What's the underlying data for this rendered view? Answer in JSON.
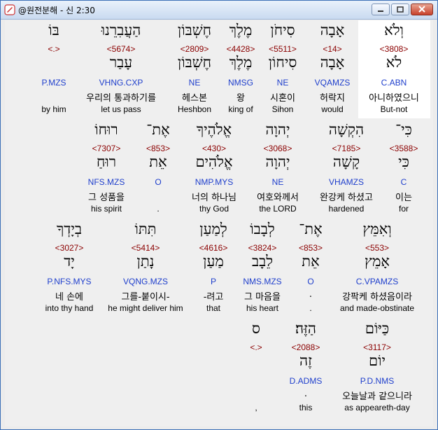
{
  "window": {
    "title": "@원전분해 - 신 2:30"
  },
  "rows": [
    {
      "id": "row1",
      "words": [
        {
          "heb": "וְלֹא",
          "strong": "<3808>",
          "lemma": "לֹא",
          "morph": "C.ABN",
          "kor": "아니하였으니",
          "eng": "But-not"
        },
        {
          "heb": "אָבָה",
          "strong": "<14>",
          "lemma": "אָבָה",
          "morph": "VQAMZS",
          "kor": "허락지",
          "eng": "would"
        },
        {
          "heb": "סִיחֹן",
          "strong": "<5511>",
          "lemma": "סִיחוֹן",
          "morph": "NE",
          "kor": "시혼이",
          "eng": "Sihon"
        },
        {
          "heb": "מֶלֶךְ",
          "strong": "<4428>",
          "lemma": "מֶלֶךְ",
          "morph": "NMSG",
          "kor": "왕",
          "eng": "king of"
        },
        {
          "heb": "חֶשְׁבּוֹן",
          "strong": "<2809>",
          "lemma": "חֶשְׁבּוֹן",
          "morph": "NE",
          "kor": "헤스본",
          "eng": "Heshbon"
        },
        {
          "heb": "הַעֲבִרֵנוּ",
          "strong": "<5674>",
          "lemma": "עָבַר",
          "morph": "VHNG.CXP",
          "kor": "우리의 통과하기를",
          "eng": "let us pass"
        },
        {
          "heb": "בּוֹ",
          "strong": "<.>",
          "lemma": "",
          "morph": "P.MZS",
          "kor": "",
          "eng": "by him"
        }
      ]
    },
    {
      "id": "row2",
      "words": [
        {
          "heb": "כִּי־",
          "strong": "<3588>",
          "lemma": "כִּי",
          "morph": "C",
          "kor": "이는",
          "eng": "for"
        },
        {
          "heb": "הִקְשָׁה",
          "strong": "<7185>",
          "lemma": "קָשָׁה",
          "morph": "VHAMZS",
          "kor": "완강케 하셨고",
          "eng": "hardened"
        },
        {
          "heb": "יְהוָה",
          "strong": "<3068>",
          "lemma": "יְהוָה",
          "morph": "NE",
          "kor": "여호와께서",
          "eng": "the LORD"
        },
        {
          "heb": "אֱלֹהֶיךָ",
          "strong": "<430>",
          "lemma": "אֱלֹהִים",
          "morph": "NMP.MYS",
          "kor": "너의 하나님",
          "eng": "thy God"
        },
        {
          "heb": "אֶת־",
          "strong": "<853>",
          "lemma": "אֵת",
          "morph": "O",
          "kor": "",
          "eng": "."
        },
        {
          "heb": "רוּחוֹ",
          "strong": "<7307>",
          "lemma": "רוּחַ",
          "morph": "NFS.MZS",
          "kor": "그 성품을",
          "eng": "his spirit"
        }
      ]
    },
    {
      "id": "row3",
      "words": [
        {
          "heb": "וְאִמֵּץ",
          "strong": "<553>",
          "lemma": "אָמֵץ",
          "morph": "C.VPAMZS",
          "kor": "강팍케 하셨음이라",
          "eng": "and made-obstinate"
        },
        {
          "heb": "אֶת־",
          "strong": "<853>",
          "lemma": "אֵת",
          "morph": "O",
          "kor": ".",
          "eng": "."
        },
        {
          "heb": "לְבָבוֹ",
          "strong": "<3824>",
          "lemma": "לֵבָב",
          "morph": "NMS.MZS",
          "kor": "그 마음을",
          "eng": "his heart"
        },
        {
          "heb": "לְמַעַן",
          "strong": "<4616>",
          "lemma": "מַעַן",
          "morph": "P",
          "kor": "-려고",
          "eng": "that"
        },
        {
          "heb": "תִּתּוֹ",
          "strong": "<5414>",
          "lemma": "נָתַן",
          "morph": "VQNG.MZS",
          "kor": "그를-붙이시-",
          "eng": "he might deliver him"
        },
        {
          "heb": "בְיָדְךָ",
          "strong": "<3027>",
          "lemma": "יָד",
          "morph": "P.NFS.MYS",
          "kor": "네 손에",
          "eng": "into thy hand"
        }
      ]
    },
    {
      "id": "row4",
      "words": [
        {
          "heb": "כַּיּוֹם",
          "strong": "<3117>",
          "lemma": "יוֹם",
          "morph": "P.D.NMS",
          "kor": "오늘날과 같으니라",
          "eng": "as appeareth-day"
        },
        {
          "heb": "הַזֶּה׃",
          "strong": "<2088>",
          "lemma": "זֶה",
          "morph": "D.ADMS",
          "kor": ".",
          "eng": "this"
        },
        {
          "heb": "ס",
          "strong": "<.>",
          "lemma": "",
          "morph": "",
          "kor": "",
          "eng": ","
        }
      ]
    }
  ]
}
